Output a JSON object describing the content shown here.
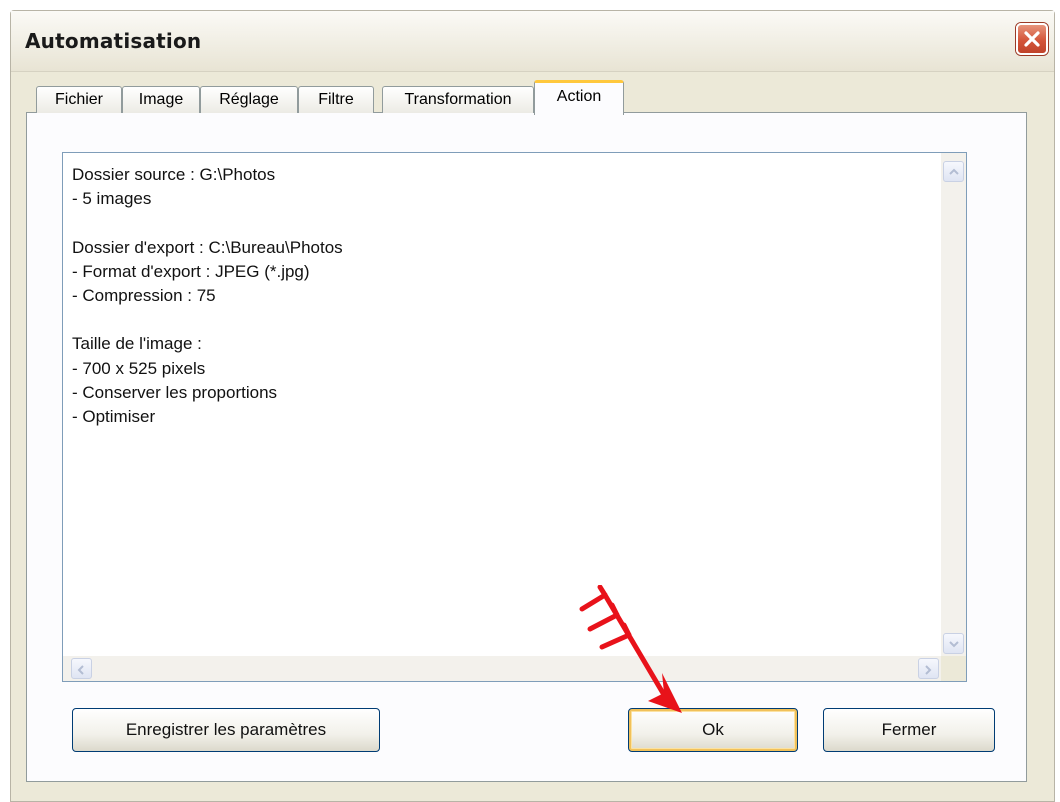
{
  "window": {
    "title": "Automatisation"
  },
  "tabs": [
    {
      "label": "Fichier",
      "active": false
    },
    {
      "label": "Image",
      "active": false
    },
    {
      "label": "Réglage",
      "active": false
    },
    {
      "label": "Filtre",
      "active": false
    },
    {
      "label": "Transformation",
      "active": false
    },
    {
      "label": "Action",
      "active": true
    }
  ],
  "summary": {
    "text": "Dossier source : G:\\Photos\n- 5 images\n\nDossier d'export : C:\\Bureau\\Photos\n- Format d'export : JPEG (*.jpg)\n- Compression : 75\n\nTaille de l'image :\n- 700 x 525 pixels\n- Conserver les proportions\n- Optimiser"
  },
  "buttons": {
    "save_params": "Enregistrer les paramètres",
    "ok": "Ok",
    "close": "Fermer"
  },
  "icons": {
    "close": "close-x-icon",
    "annotation": "red-arrow-icon"
  },
  "colors": {
    "close_button": "#d4553a",
    "active_tab_accent": "#ffc83c",
    "annotation_arrow": "#e8121a"
  }
}
